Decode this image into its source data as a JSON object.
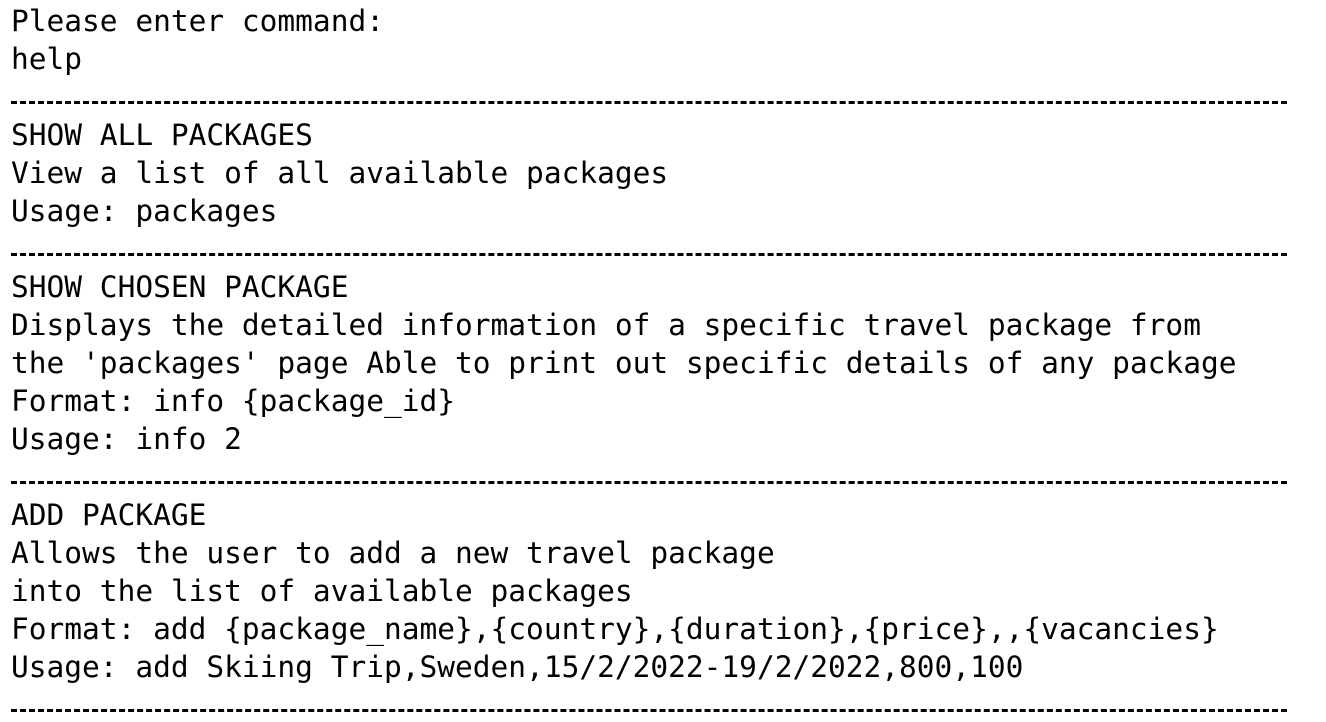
{
  "terminal": {
    "prompt": "Please enter command:",
    "input": "help",
    "sections": [
      {
        "title": "SHOW ALL PACKAGES",
        "lines": [
          "View a list of all available packages",
          "Usage: packages"
        ]
      },
      {
        "title": "SHOW CHOSEN PACKAGE",
        "lines": [
          "Displays the detailed information of a specific travel package from",
          "the 'packages' page Able to print out specific details of any package",
          "Format: info {package_id}",
          "Usage: info 2"
        ]
      },
      {
        "title": "ADD PACKAGE",
        "lines": [
          "Allows the user to add a new travel package",
          "into the list of available packages",
          "Format: add {package_name},{country},{duration},{price},,{vacancies}",
          "Usage: add Skiing Trip,Sweden,15/2/2022-19/2/2022,800,100"
        ]
      }
    ]
  }
}
